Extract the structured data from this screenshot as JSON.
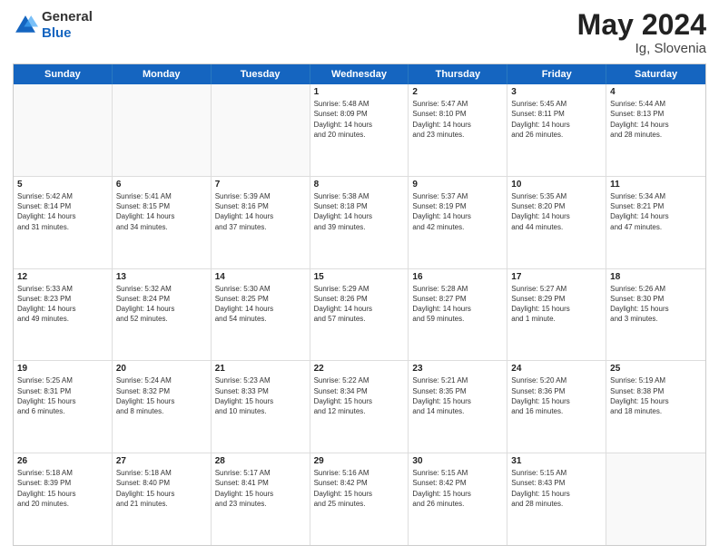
{
  "header": {
    "logo_line1": "General",
    "logo_line2": "Blue",
    "title": "May 2024",
    "location": "Ig, Slovenia"
  },
  "days_of_week": [
    "Sunday",
    "Monday",
    "Tuesday",
    "Wednesday",
    "Thursday",
    "Friday",
    "Saturday"
  ],
  "rows": [
    [
      {
        "day": "",
        "info": ""
      },
      {
        "day": "",
        "info": ""
      },
      {
        "day": "",
        "info": ""
      },
      {
        "day": "1",
        "info": "Sunrise: 5:48 AM\nSunset: 8:09 PM\nDaylight: 14 hours\nand 20 minutes."
      },
      {
        "day": "2",
        "info": "Sunrise: 5:47 AM\nSunset: 8:10 PM\nDaylight: 14 hours\nand 23 minutes."
      },
      {
        "day": "3",
        "info": "Sunrise: 5:45 AM\nSunset: 8:11 PM\nDaylight: 14 hours\nand 26 minutes."
      },
      {
        "day": "4",
        "info": "Sunrise: 5:44 AM\nSunset: 8:13 PM\nDaylight: 14 hours\nand 28 minutes."
      }
    ],
    [
      {
        "day": "5",
        "info": "Sunrise: 5:42 AM\nSunset: 8:14 PM\nDaylight: 14 hours\nand 31 minutes."
      },
      {
        "day": "6",
        "info": "Sunrise: 5:41 AM\nSunset: 8:15 PM\nDaylight: 14 hours\nand 34 minutes."
      },
      {
        "day": "7",
        "info": "Sunrise: 5:39 AM\nSunset: 8:16 PM\nDaylight: 14 hours\nand 37 minutes."
      },
      {
        "day": "8",
        "info": "Sunrise: 5:38 AM\nSunset: 8:18 PM\nDaylight: 14 hours\nand 39 minutes."
      },
      {
        "day": "9",
        "info": "Sunrise: 5:37 AM\nSunset: 8:19 PM\nDaylight: 14 hours\nand 42 minutes."
      },
      {
        "day": "10",
        "info": "Sunrise: 5:35 AM\nSunset: 8:20 PM\nDaylight: 14 hours\nand 44 minutes."
      },
      {
        "day": "11",
        "info": "Sunrise: 5:34 AM\nSunset: 8:21 PM\nDaylight: 14 hours\nand 47 minutes."
      }
    ],
    [
      {
        "day": "12",
        "info": "Sunrise: 5:33 AM\nSunset: 8:23 PM\nDaylight: 14 hours\nand 49 minutes."
      },
      {
        "day": "13",
        "info": "Sunrise: 5:32 AM\nSunset: 8:24 PM\nDaylight: 14 hours\nand 52 minutes."
      },
      {
        "day": "14",
        "info": "Sunrise: 5:30 AM\nSunset: 8:25 PM\nDaylight: 14 hours\nand 54 minutes."
      },
      {
        "day": "15",
        "info": "Sunrise: 5:29 AM\nSunset: 8:26 PM\nDaylight: 14 hours\nand 57 minutes."
      },
      {
        "day": "16",
        "info": "Sunrise: 5:28 AM\nSunset: 8:27 PM\nDaylight: 14 hours\nand 59 minutes."
      },
      {
        "day": "17",
        "info": "Sunrise: 5:27 AM\nSunset: 8:29 PM\nDaylight: 15 hours\nand 1 minute."
      },
      {
        "day": "18",
        "info": "Sunrise: 5:26 AM\nSunset: 8:30 PM\nDaylight: 15 hours\nand 3 minutes."
      }
    ],
    [
      {
        "day": "19",
        "info": "Sunrise: 5:25 AM\nSunset: 8:31 PM\nDaylight: 15 hours\nand 6 minutes."
      },
      {
        "day": "20",
        "info": "Sunrise: 5:24 AM\nSunset: 8:32 PM\nDaylight: 15 hours\nand 8 minutes."
      },
      {
        "day": "21",
        "info": "Sunrise: 5:23 AM\nSunset: 8:33 PM\nDaylight: 15 hours\nand 10 minutes."
      },
      {
        "day": "22",
        "info": "Sunrise: 5:22 AM\nSunset: 8:34 PM\nDaylight: 15 hours\nand 12 minutes."
      },
      {
        "day": "23",
        "info": "Sunrise: 5:21 AM\nSunset: 8:35 PM\nDaylight: 15 hours\nand 14 minutes."
      },
      {
        "day": "24",
        "info": "Sunrise: 5:20 AM\nSunset: 8:36 PM\nDaylight: 15 hours\nand 16 minutes."
      },
      {
        "day": "25",
        "info": "Sunrise: 5:19 AM\nSunset: 8:38 PM\nDaylight: 15 hours\nand 18 minutes."
      }
    ],
    [
      {
        "day": "26",
        "info": "Sunrise: 5:18 AM\nSunset: 8:39 PM\nDaylight: 15 hours\nand 20 minutes."
      },
      {
        "day": "27",
        "info": "Sunrise: 5:18 AM\nSunset: 8:40 PM\nDaylight: 15 hours\nand 21 minutes."
      },
      {
        "day": "28",
        "info": "Sunrise: 5:17 AM\nSunset: 8:41 PM\nDaylight: 15 hours\nand 23 minutes."
      },
      {
        "day": "29",
        "info": "Sunrise: 5:16 AM\nSunset: 8:42 PM\nDaylight: 15 hours\nand 25 minutes."
      },
      {
        "day": "30",
        "info": "Sunrise: 5:15 AM\nSunset: 8:42 PM\nDaylight: 15 hours\nand 26 minutes."
      },
      {
        "day": "31",
        "info": "Sunrise: 5:15 AM\nSunset: 8:43 PM\nDaylight: 15 hours\nand 28 minutes."
      },
      {
        "day": "",
        "info": ""
      }
    ]
  ]
}
